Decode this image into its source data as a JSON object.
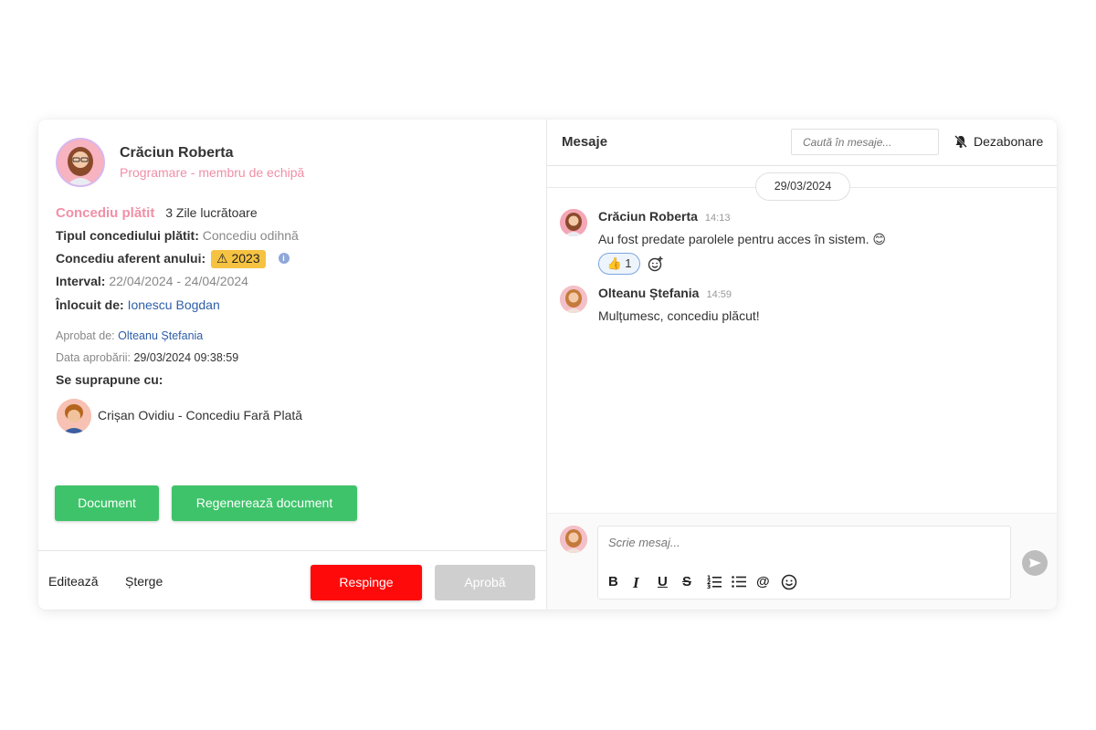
{
  "request": {
    "person_name": "Crăciun Roberta",
    "person_role": "Programare - membru de echipă",
    "leave_type": "Concediu plătit",
    "days": "3 Zile lucrătoare",
    "paid_type_label": "Tipul concediului plătit:",
    "paid_type_value": "Concediu odihnă",
    "year_label": "Concediu aferent anului:",
    "year_value": "2023",
    "interval_label": "Interval:",
    "interval_value": "22/04/2024 - 24/04/2024",
    "replaced_label": "Înlocuit de:",
    "replaced_value": "Ionescu Bogdan",
    "approved_by_label": "Aprobat de:",
    "approved_by_value": "Olteanu Ștefania",
    "approval_date_label": "Data aprobării:",
    "approval_date_value": "29/03/2024 09:38:59",
    "overlap_label": "Se suprapune cu:",
    "overlap_item": "Crișan Ovidiu - Concediu Fară Plată"
  },
  "buttons": {
    "document": "Document",
    "regenerate": "Regenerează document",
    "edit": "Editează",
    "delete": "Șterge",
    "reject": "Respinge",
    "approve": "Aprobă"
  },
  "messages_panel": {
    "title": "Mesaje",
    "search_placeholder": "Caută în mesaje...",
    "unsubscribe": "Dezabonare",
    "date": "29/03/2024",
    "messages": [
      {
        "author": "Crăciun Roberta",
        "time": "14:13",
        "text": "Au fost predate parolele pentru acces în sistem. 😊"
      },
      {
        "author": "Olteanu Ștefania",
        "time": "14:59",
        "text": "Mulțumesc, concediu plăcut!"
      }
    ],
    "reaction": {
      "emoji": "👍",
      "count": "1"
    },
    "composer_placeholder": "Scrie mesaj...",
    "toolbar": [
      "B",
      "I",
      "U",
      "S"
    ]
  },
  "colors": {
    "accent_pink": "#f28fa6",
    "green": "#3ec36a",
    "red": "#ff0a0a",
    "badge_yellow": "#f5c242",
    "link_blue": "#2e5ea8"
  }
}
